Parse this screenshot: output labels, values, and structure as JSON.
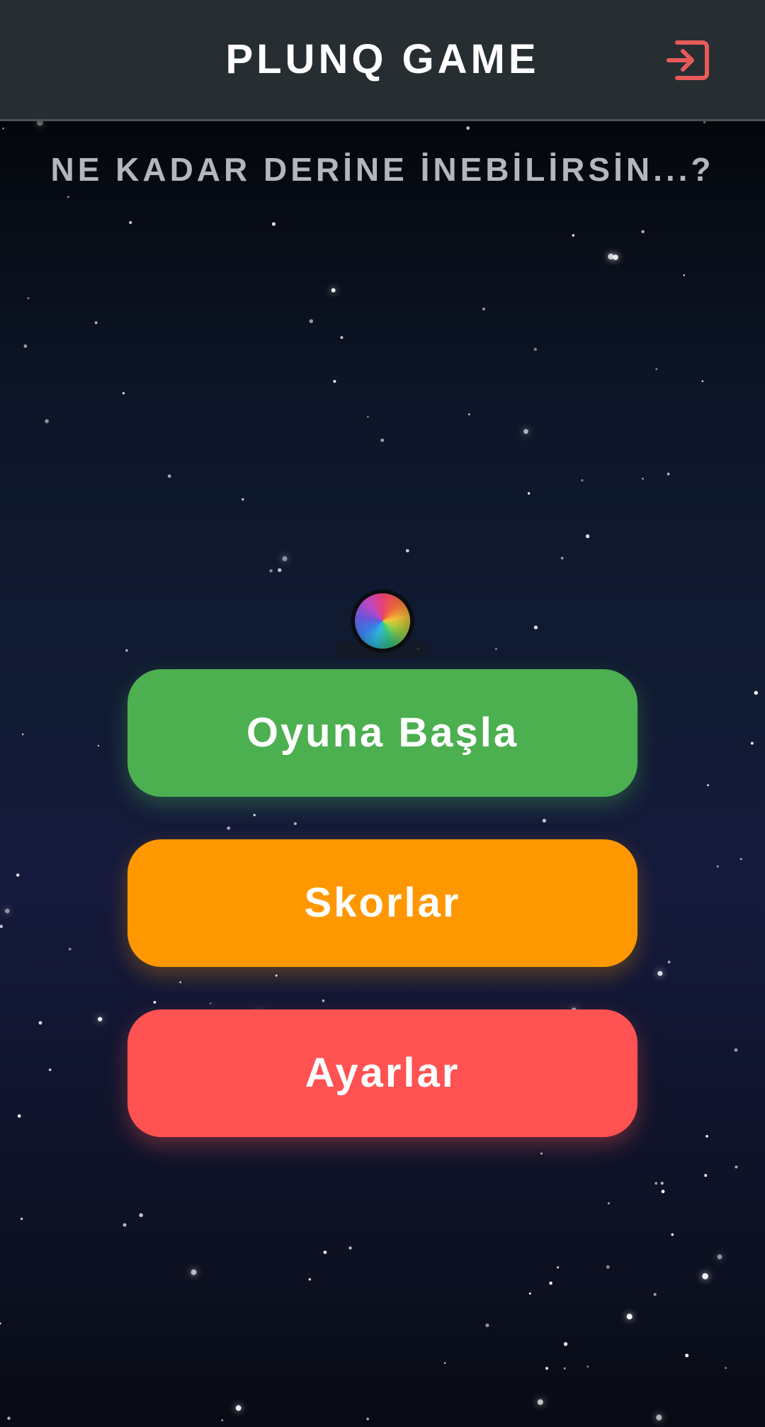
{
  "header": {
    "title": "PLUNQ GAME",
    "logout_icon": "logout-icon",
    "logout_color": "#e85a5a"
  },
  "tagline": "NE KADAR DERİNE İNEBİLİRSİN...?",
  "ball": {
    "icon": "rainbow-ball-icon"
  },
  "menu": {
    "start_label": "Oyuna Başla",
    "scores_label": "Skorlar",
    "settings_label": "Ayarlar"
  },
  "colors": {
    "header_bg": "#2c3438",
    "start": "#4caf50",
    "scores": "#ff9800",
    "settings": "#ff5252",
    "tagline": "#b3b6bb"
  }
}
